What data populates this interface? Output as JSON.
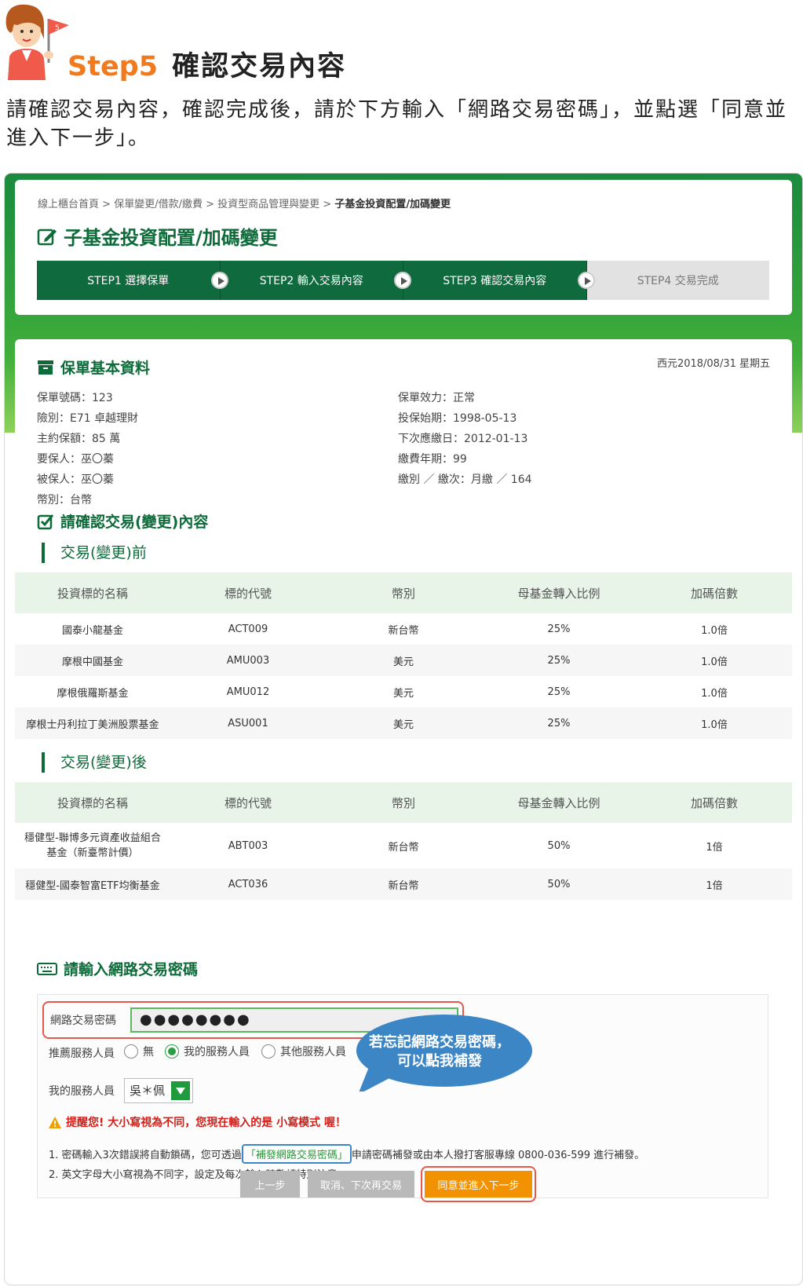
{
  "header": {
    "step_label": "Step5",
    "title": "確認交易內容",
    "flag_number": "5",
    "intro": "請確認交易內容，確認完成後，請於下方輸入「網路交易密碼」，並點選「同意並進入下一步」。"
  },
  "breadcrumb": [
    "線上櫃台首頁",
    "保單變更/借款/繳費",
    "投資型商品管理與變更",
    "子基金投資配置/加碼變更"
  ],
  "page_title": "子基金投資配置/加碼變更",
  "steps": [
    "STEP1 選擇保單",
    "STEP2 輸入交易內容",
    "STEP3 確認交易內容",
    "STEP4 交易完成"
  ],
  "policy": {
    "title": "保單基本資料",
    "date": "西元2018/08/31 星期五",
    "left": [
      "保單號碼：123",
      "險別：E71 卓越理財",
      "主約保額：85 萬",
      "要保人：巫〇蓁",
      "被保人：巫〇蓁",
      "幣別：台幣"
    ],
    "right": [
      "保單效力：正常",
      "投保始期：1998-05-13",
      "下次應繳日：2012-01-13",
      "繳費年期：99",
      "繳別 ／ 繳次：月繳 ／ 164"
    ]
  },
  "confirm_title": "請確認交易(變更)內容",
  "before": {
    "title": "交易(變更)前",
    "headers": [
      "投資標的名稱",
      "標的代號",
      "幣別",
      "母基金轉入比例",
      "加碼倍數"
    ],
    "rows": [
      [
        "國泰小龍基金",
        "ACT009",
        "新台幣",
        "25%",
        "1.0倍"
      ],
      [
        "摩根中國基金",
        "AMU003",
        "美元",
        "25%",
        "1.0倍"
      ],
      [
        "摩根俄羅斯基金",
        "AMU012",
        "美元",
        "25%",
        "1.0倍"
      ],
      [
        "摩根士丹利拉丁美洲股票基金",
        "ASU001",
        "美元",
        "25%",
        "1.0倍"
      ]
    ]
  },
  "after": {
    "title": "交易(變更)後",
    "headers": [
      "投資標的名稱",
      "標的代號",
      "幣別",
      "母基金轉入比例",
      "加碼倍數"
    ],
    "rows": [
      [
        "穩健型-聯博多元資產收益組合\n基金（新臺幣計價）",
        "ABT003",
        "新台幣",
        "50%",
        "1倍"
      ],
      [
        "穩健型-國泰智富ETF均衡基金",
        "ACT036",
        "新台幣",
        "50%",
        "1倍"
      ]
    ]
  },
  "password": {
    "title": "請輸入網路交易密碼",
    "label": "網路交易密碼",
    "value": "●●●●●●●●",
    "recommend_label": "推薦服務人員",
    "options": [
      "無",
      "我的服務人員",
      "其他服務人員"
    ],
    "selected_option": "我的服務人員",
    "my_agent_label": "我的服務人員",
    "my_agent_value": "吳＊佩",
    "warning": "提醒您! 大小寫視為不同，您現在輸入的是 小寫模式 喔！",
    "note1_pre": "1. 密碼輸入3次錯誤將自動鎖碼，您可透過",
    "note1_link": "「補發網路交易密碼」",
    "note1_post": "申請密碼補發或由本人撥打客服專線 0800-036-599 進行補發。",
    "note2": "2. 英文字母大小寫視為不同字，設定及每次輸入時敬請特別注意。"
  },
  "bubble": {
    "line1": "若忘記網路交易密碼，",
    "line2": "可以點我補發"
  },
  "buttons": {
    "prev": "上一步",
    "cancel": "取消、下次再交易",
    "next": "同意並進入下一步"
  },
  "colors": {
    "brand_green": "#0f6a3e",
    "accent_orange": "#f07a1d",
    "button_orange": "#f39200",
    "highlight_red": "#e8584a",
    "bubble_blue": "#3d86c6"
  }
}
